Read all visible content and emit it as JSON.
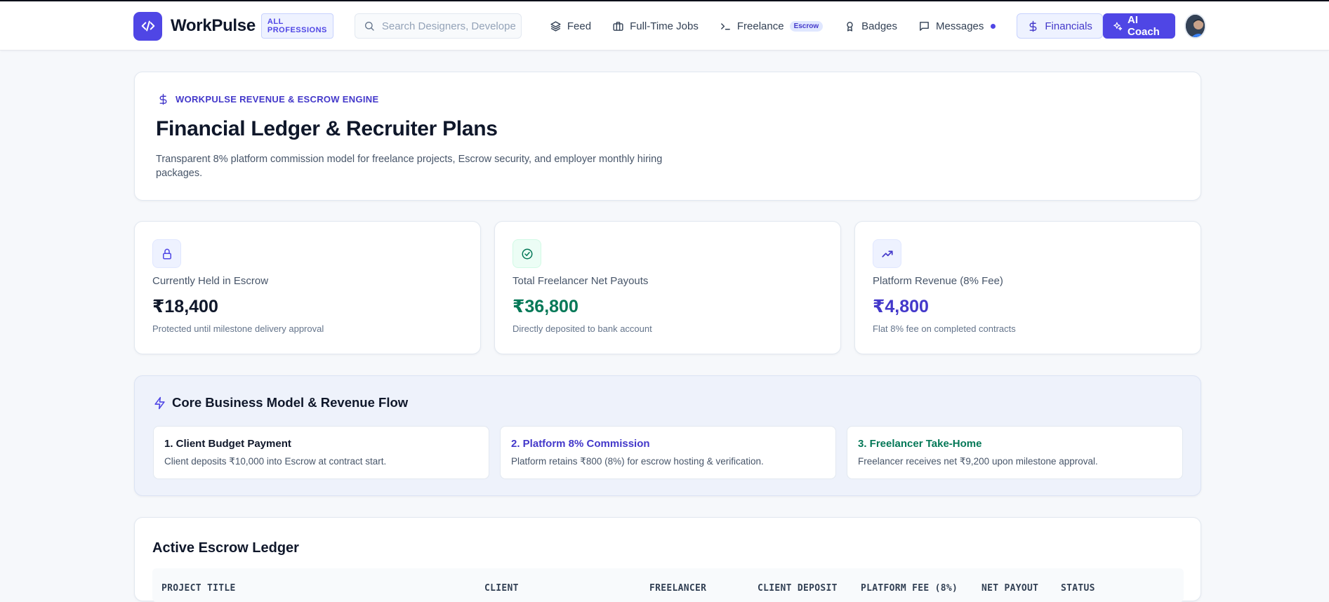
{
  "nav": {
    "brand": "WorkPulse",
    "brand_badge": "ALL PROFESSIONS",
    "search_placeholder": "Search Designers, Developers...",
    "links": {
      "feed": "Feed",
      "jobs": "Full-Time Jobs",
      "freelance": "Freelance",
      "freelance_badge": "Escrow",
      "badges": "Badges",
      "messages": "Messages",
      "financials": "Financials"
    },
    "ai_coach": "AI Coach"
  },
  "hero": {
    "eyebrow": "WORKPULSE REVENUE & ESCROW ENGINE",
    "title": "Financial Ledger & Recruiter Plans",
    "description": "Transparent 8% platform commission model for freelance projects, Escrow security, and employer monthly hiring packages."
  },
  "stats": [
    {
      "label": "Currently Held in Escrow",
      "value": "₹18,400",
      "sub": "Protected until milestone delivery approval",
      "color": "#0f172a",
      "icon": "lock-icon"
    },
    {
      "label": "Total Freelancer Net Payouts",
      "value": "₹36,800",
      "sub": "Directly deposited to bank account",
      "color": "#047857",
      "icon": "check-circle-icon"
    },
    {
      "label": "Platform Revenue (8% Fee)",
      "value": "₹4,800",
      "sub": "Flat 8% fee on completed contracts",
      "color": "#4338ca",
      "icon": "trending-up-icon"
    }
  ],
  "flow": {
    "title": "Core Business Model & Revenue Flow",
    "steps": [
      {
        "title": "1. Client Budget Payment",
        "desc": "Client deposits ₹10,000 into Escrow at contract start.",
        "color": "#0f172a"
      },
      {
        "title": "2. Platform 8% Commission",
        "desc": "Platform retains ₹800 (8%) for escrow hosting & verification.",
        "color": "#4338ca"
      },
      {
        "title": "3. Freelancer Take-Home",
        "desc": "Freelancer receives net ₹9,200 upon milestone approval.",
        "color": "#047857"
      }
    ]
  },
  "ledger": {
    "title": "Active Escrow Ledger",
    "columns": [
      "PROJECT TITLE",
      "CLIENT",
      "FREELANCER",
      "CLIENT DEPOSIT",
      "PLATFORM FEE (8%)",
      "NET PAYOUT",
      "STATUS"
    ]
  },
  "colors": {
    "accent": "#4f46e5",
    "success": "#047857"
  }
}
